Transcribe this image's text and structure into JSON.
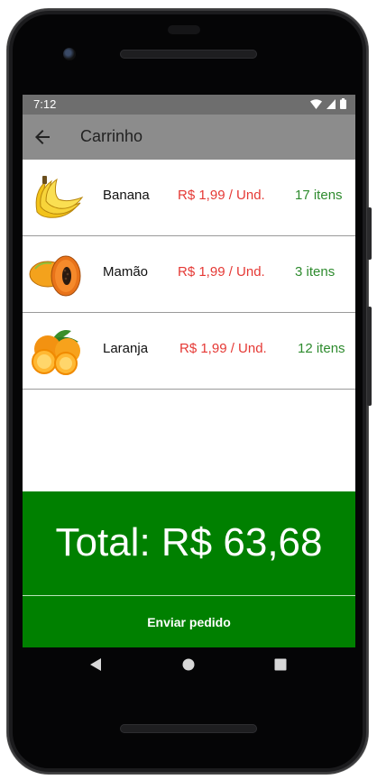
{
  "status_bar": {
    "time": "7:12"
  },
  "app_bar": {
    "title": "Carrinho"
  },
  "items": [
    {
      "name": "Banana",
      "price": "R$ 1,99 / Und.",
      "quantity": "17 itens",
      "icon": "banana-icon"
    },
    {
      "name": "Mamão",
      "price": "R$ 1,99 / Und.",
      "quantity": "3 itens",
      "icon": "papaya-icon"
    },
    {
      "name": "Laranja",
      "price": "R$ 1,99 / Und.",
      "quantity": "12 itens",
      "icon": "orange-icon"
    }
  ],
  "total": {
    "label": "Total: R$ 63,68"
  },
  "actions": {
    "send_label": "Enviar pedido"
  },
  "colors": {
    "accent": "#008000",
    "price": "#e53935",
    "quantity": "#2e8b2e",
    "app_bar": "#8c8c8c",
    "status_bar": "#6e6e6e"
  }
}
